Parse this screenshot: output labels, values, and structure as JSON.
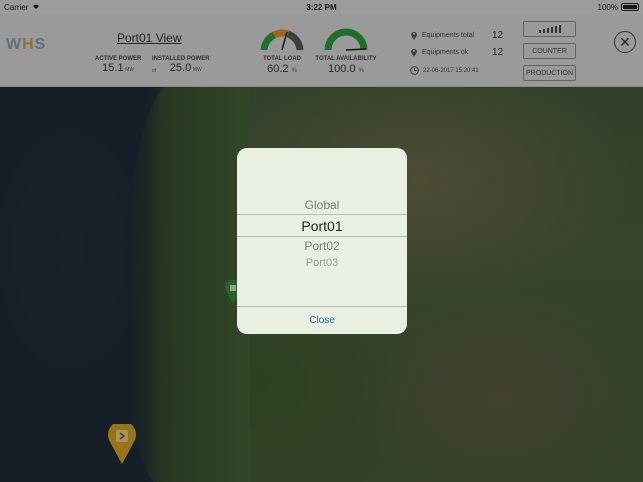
{
  "status_bar": {
    "carrier": "Carrier",
    "time": "3:22 PM",
    "battery": "100%"
  },
  "header": {
    "logo": "WHS",
    "title": "Port01 View",
    "active_power": {
      "label": "ACTIVE POWER",
      "value": "15.1",
      "unit": "MW"
    },
    "installed_power": {
      "label": "INSTALLED POWER",
      "of": "of",
      "value": "25.0",
      "unit": "MW"
    },
    "total_load": {
      "label": "TOTAL LOAD",
      "value": "60.2",
      "unit": "%",
      "level": 0.602
    },
    "total_availability": {
      "label": "TOTAL AVAILABILITY",
      "value": "100.0",
      "unit": "%",
      "level": 1.0
    },
    "equipments_total": {
      "label": "Equipments total",
      "value": "12"
    },
    "equipments_ok": {
      "label": "Equipments ok",
      "value": "12"
    },
    "datetime": "22-06-2017 15:20:41",
    "buttons": {
      "counter": "COUNTER",
      "production": "PRODUCTION"
    }
  },
  "picker": {
    "options": [
      "Global",
      "Port01",
      "Port02",
      "Port03"
    ],
    "selected": "Port01",
    "close_label": "Close"
  },
  "colors": {
    "accent": "#1a6fd6",
    "gauge_green": "#2a9a3a",
    "gauge_orange": "#e08a20",
    "marker_yellow": "#d4a020"
  }
}
